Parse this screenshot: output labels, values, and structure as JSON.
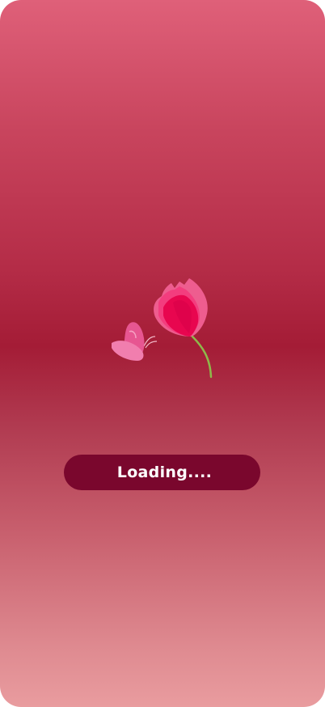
{
  "splash": {
    "logo_icon": "butterfly-tulip-icon",
    "loading_text": "Loading...."
  },
  "colors": {
    "background_top": "#df6079",
    "background_middle": "#a41c36",
    "background_bottom": "#e99c9f",
    "pill": "#7a072d",
    "tulip": "#e8064f",
    "stem": "#8eb84a"
  }
}
